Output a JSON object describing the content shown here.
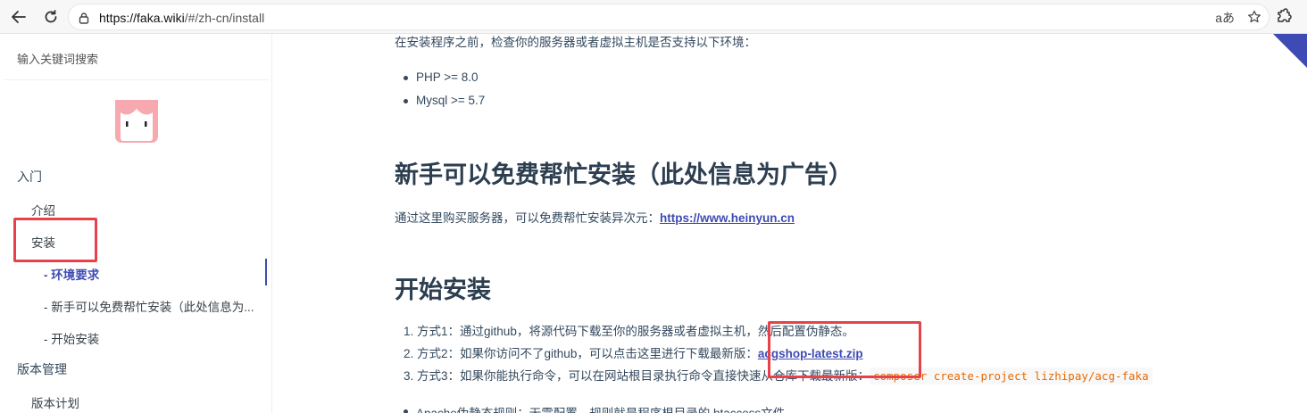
{
  "browser": {
    "url_host": "https://faka.wiki",
    "url_path": "/#/zh-cn/install",
    "read_aloud_label": "aあ"
  },
  "sidebar": {
    "search_placeholder": "输入关键词搜索",
    "items": [
      {
        "label": "入门"
      },
      {
        "label": "介绍"
      },
      {
        "label": "安装"
      },
      {
        "label": "- 环境要求"
      },
      {
        "label": "- 新手可以免费帮忙安装（此处信息为..."
      },
      {
        "label": "- 开始安装"
      },
      {
        "label": "版本管理"
      },
      {
        "label": "版本计划"
      }
    ]
  },
  "content": {
    "intro_text": "在安装程序之前，检查你的服务器或者虚拟主机是否支持以下环境：",
    "requirements": [
      "PHP >= 8.0",
      "Mysql >= 5.7"
    ],
    "section_free_install": {
      "heading": "新手可以免费帮忙安装（此处信息为广告）",
      "text": "通过这里购买服务器，可以免费帮忙安装异次元：",
      "link": "https://www.heinyun.cn"
    },
    "section_start_install": {
      "heading": "开始安装",
      "methods": [
        {
          "num": "1.",
          "text": "方式1：通过github，将源代码下载至你的服务器或者虚拟主机，然后配置伪静态。"
        },
        {
          "num": "2.",
          "text": "方式2：如果你访问不了github，可以点击这里进行下载最新版：",
          "link": "acgshop-latest.zip"
        },
        {
          "num": "3.",
          "text": "方式3：如果你能执行命令，可以在网站根目录执行命令直接快速从仓库下载最新版：",
          "code": "composer create-project lizhipay/acg-faka"
        }
      ],
      "apache_note": "Apache伪静态规则：无需配置，规则就是程序根目录的.htaccess文件"
    }
  },
  "colors": {
    "accent": "#3f4bb5",
    "highlight": "#e8414a",
    "text": "#34495e",
    "code": "#e96900"
  }
}
